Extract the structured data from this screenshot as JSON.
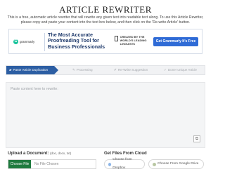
{
  "page": {
    "title": "ARTICLE REWRITER",
    "intro": "This is a free, automatic article rewriter that will rewrite any given text into readable text along. To use this Article Rewriter, please copy and paste your content into the text box below, and then click on the 'Re-write Article' button."
  },
  "ad": {
    "brand": "grammarly",
    "headline": "The Most Accurate Proofreading Tool for Business Professionals",
    "badge": "CREATED BY THE WORLD'S LEADING LINGUISTS",
    "cta": "Get Grammarly It's Free",
    "colors": {
      "brand": "#15c39a",
      "cta": "#2f6bd6",
      "headline": "#1f3a6b"
    }
  },
  "steps": [
    {
      "label": "Paste Article Duplication",
      "icon": "folder-icon",
      "active": true
    },
    {
      "label": "Processing",
      "icon": "pencil-icon",
      "active": false
    },
    {
      "label": "Re-Write Suggestion",
      "icon": "edit-icon",
      "active": false
    },
    {
      "label": "Done! unique Article",
      "icon": "check-icon",
      "active": false
    }
  ],
  "editor": {
    "placeholder": "Paste content here to rewrite:"
  },
  "upload": {
    "label": "Upload a Document:",
    "formats": "(doc, docx, txt)",
    "choose_label": "Choose File",
    "no_file_label": "No File Chosen"
  },
  "cloud": {
    "label": "Get Files From Cloud",
    "dropbox_label": "Choose from Dropbox",
    "drive_label": "Choose From Google Drive"
  },
  "colors": {
    "accent": "#2c5ea3",
    "choose_button": "#1f7a3e"
  }
}
